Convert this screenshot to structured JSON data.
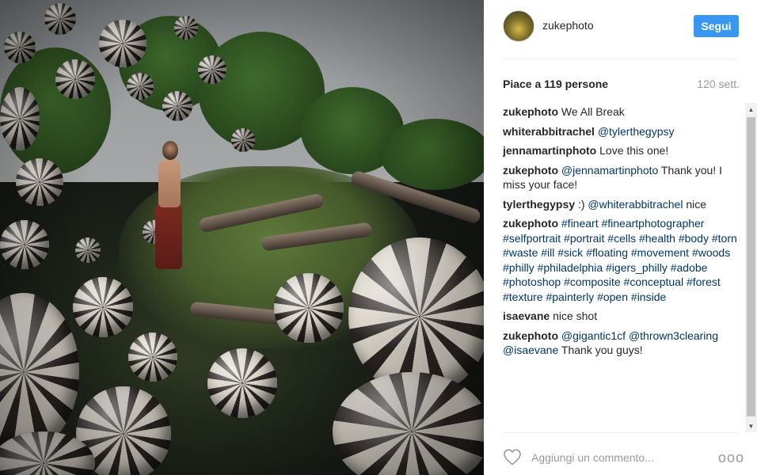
{
  "post": {
    "image_icon": "photo-surreal-spheres",
    "username": "zukephoto",
    "follow_label": "Segui",
    "likes_text": "Piace a 119 persone",
    "time_text": "120 sett."
  },
  "comments": [
    {
      "author": "zukephoto",
      "parts": [
        {
          "t": "text",
          "v": "We All Break"
        }
      ]
    },
    {
      "author": "whiterabbitrachel",
      "parts": [
        {
          "t": "mention",
          "v": "@tylerthegypsy"
        }
      ]
    },
    {
      "author": "jennamartinphoto",
      "parts": [
        {
          "t": "text",
          "v": "Love this one!"
        }
      ]
    },
    {
      "author": "zukephoto",
      "parts": [
        {
          "t": "mention",
          "v": "@jennamartinphoto"
        },
        {
          "t": "text",
          "v": " Thank you! I miss your face!"
        }
      ]
    },
    {
      "author": "tylerthegypsy",
      "parts": [
        {
          "t": "text",
          "v": ":) "
        },
        {
          "t": "mention",
          "v": "@whiterabbitrachel"
        },
        {
          "t": "text",
          "v": " nice"
        }
      ]
    },
    {
      "author": "zukephoto",
      "parts": [
        {
          "t": "tag",
          "v": "#fineart"
        },
        {
          "t": "text",
          "v": " "
        },
        {
          "t": "tag",
          "v": "#fineartphotographer"
        },
        {
          "t": "text",
          "v": " "
        },
        {
          "t": "tag",
          "v": "#selfportrait"
        },
        {
          "t": "text",
          "v": " "
        },
        {
          "t": "tag",
          "v": "#portrait"
        },
        {
          "t": "text",
          "v": " "
        },
        {
          "t": "tag",
          "v": "#cells"
        },
        {
          "t": "text",
          "v": " "
        },
        {
          "t": "tag",
          "v": "#health"
        },
        {
          "t": "text",
          "v": " "
        },
        {
          "t": "tag",
          "v": "#body"
        },
        {
          "t": "text",
          "v": " "
        },
        {
          "t": "tag",
          "v": "#torn"
        },
        {
          "t": "text",
          "v": " "
        },
        {
          "t": "tag",
          "v": "#waste"
        },
        {
          "t": "text",
          "v": " "
        },
        {
          "t": "tag",
          "v": "#ill"
        },
        {
          "t": "text",
          "v": " "
        },
        {
          "t": "tag",
          "v": "#sick"
        },
        {
          "t": "text",
          "v": " "
        },
        {
          "t": "tag",
          "v": "#floating"
        },
        {
          "t": "text",
          "v": " "
        },
        {
          "t": "tag",
          "v": "#movement"
        },
        {
          "t": "text",
          "v": " "
        },
        {
          "t": "tag",
          "v": "#woods"
        },
        {
          "t": "text",
          "v": " "
        },
        {
          "t": "tag",
          "v": "#philly"
        },
        {
          "t": "text",
          "v": " "
        },
        {
          "t": "tag",
          "v": "#philadelphia"
        },
        {
          "t": "text",
          "v": " "
        },
        {
          "t": "tag",
          "v": "#igers_philly"
        },
        {
          "t": "text",
          "v": " "
        },
        {
          "t": "tag",
          "v": "#adobe"
        },
        {
          "t": "text",
          "v": " "
        },
        {
          "t": "tag",
          "v": "#photoshop"
        },
        {
          "t": "text",
          "v": " "
        },
        {
          "t": "tag",
          "v": "#composite"
        },
        {
          "t": "text",
          "v": " "
        },
        {
          "t": "tag",
          "v": "#conceptual"
        },
        {
          "t": "text",
          "v": " "
        },
        {
          "t": "tag",
          "v": "#forest"
        },
        {
          "t": "text",
          "v": " "
        },
        {
          "t": "tag",
          "v": "#texture"
        },
        {
          "t": "text",
          "v": " "
        },
        {
          "t": "tag",
          "v": "#painterly"
        },
        {
          "t": "text",
          "v": " "
        },
        {
          "t": "tag",
          "v": "#open"
        },
        {
          "t": "text",
          "v": " "
        },
        {
          "t": "tag",
          "v": "#inside"
        }
      ]
    },
    {
      "author": "isaevane",
      "parts": [
        {
          "t": "text",
          "v": "nice shot"
        }
      ]
    },
    {
      "author": "zukephoto",
      "parts": [
        {
          "t": "mention",
          "v": "@gigantic1cf"
        },
        {
          "t": "text",
          "v": " "
        },
        {
          "t": "mention",
          "v": "@thrown3clearing"
        },
        {
          "t": "text",
          "v": " "
        },
        {
          "t": "mention",
          "v": "@isaevane"
        },
        {
          "t": "text",
          "v": " Thank you guys!"
        }
      ]
    }
  ],
  "footer": {
    "heart_icon": "heart-outline-icon",
    "comment_placeholder": "Aggiungi un commento...",
    "comment_value": "",
    "more_icon": "more-options-icon",
    "more_glyph": "ooo"
  },
  "scrollbar": {
    "up_glyph": "▲",
    "down_glyph": "▼"
  },
  "colors": {
    "accent": "#3897f0",
    "link": "#003569",
    "muted": "#999999",
    "text": "#262626"
  }
}
